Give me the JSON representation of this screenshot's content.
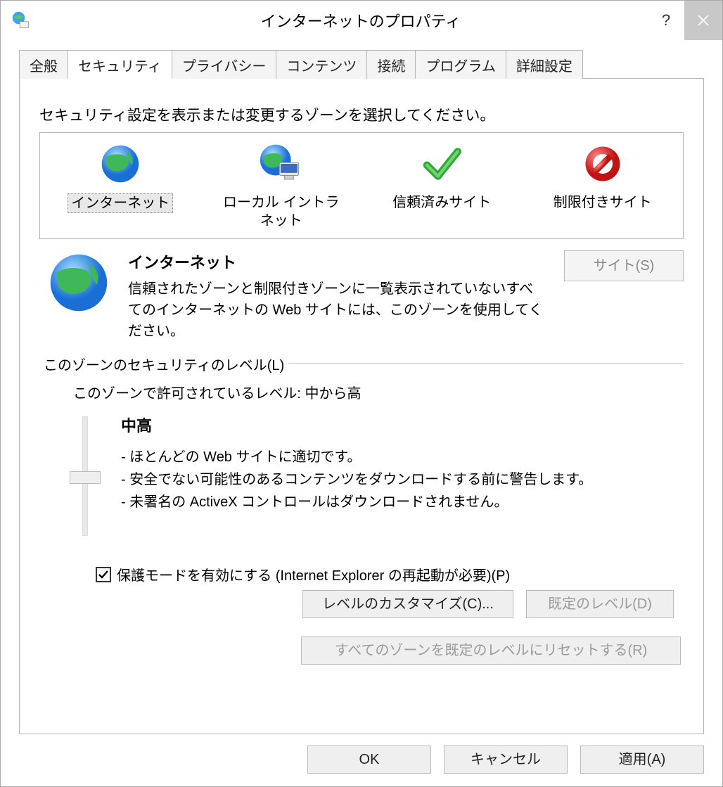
{
  "window": {
    "title": "インターネットのプロパティ"
  },
  "tabs": [
    {
      "label": "全般"
    },
    {
      "label": "セキュリティ"
    },
    {
      "label": "プライバシー"
    },
    {
      "label": "コンテンツ"
    },
    {
      "label": "接続"
    },
    {
      "label": "プログラム"
    },
    {
      "label": "詳細設定"
    }
  ],
  "panel": {
    "instruction": "セキュリティ設定を表示または変更するゾーンを選択してください。",
    "zones": [
      {
        "label": "インターネット"
      },
      {
        "label": "ローカル イントラネット"
      },
      {
        "label": "信頼済みサイト"
      },
      {
        "label": "制限付きサイト"
      }
    ],
    "active_zone": {
      "name": "インターネット",
      "description": "信頼されたゾーンと制限付きゾーンに一覧表示されていないすべてのインターネットの Web サイトには、このゾーンを使用してください。",
      "sites_button": "サイト(S)"
    },
    "security_level": {
      "legend": "このゾーンのセキュリティのレベル(L)",
      "allowed_levels": "このゾーンで許可されているレベル: 中から高",
      "current_level_name": "中高",
      "bullets": [
        "- ほとんどの Web サイトに適切です。",
        "- 安全でない可能性のあるコンテンツをダウンロードする前に警告します。",
        "- 未署名の ActiveX コントロールはダウンロードされません。"
      ],
      "protected_mode_label": "保護モードを有効にする (Internet Explorer の再起動が必要)(P)",
      "protected_mode_checked": true,
      "customize_button": "レベルのカスタマイズ(C)...",
      "default_button": "既定のレベル(D)",
      "reset_all_button": "すべてのゾーンを既定のレベルにリセットする(R)"
    }
  },
  "dialog_buttons": {
    "ok": "OK",
    "cancel": "キャンセル",
    "apply": "適用(A)"
  }
}
